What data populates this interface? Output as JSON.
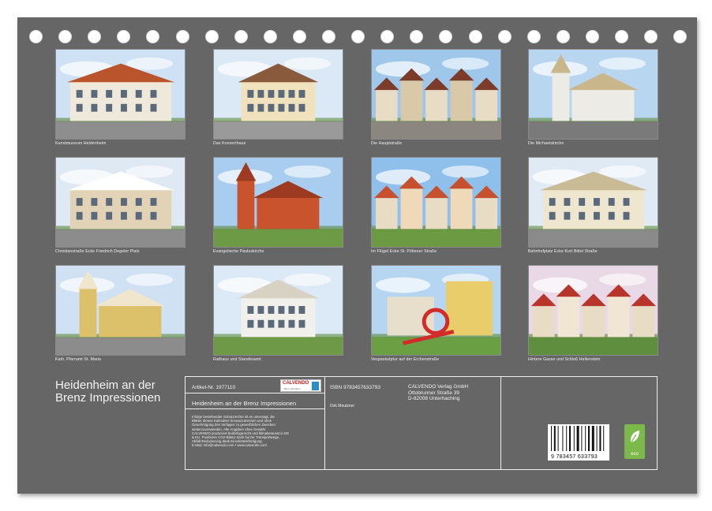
{
  "title": "Heidenheim an der Brenz Impressionen",
  "photos": [
    {
      "caption": "Kunstmuseum Heidenheim",
      "icon": "building-photo"
    },
    {
      "caption": "Das Konzerthaus",
      "icon": "building-photo"
    },
    {
      "caption": "Die Hauptstraße",
      "icon": "street-photo"
    },
    {
      "caption": "Die Michaelskirche",
      "icon": "church-photo"
    },
    {
      "caption": "Christianstraße Ecke Friedrich Degeler Platz",
      "icon": "building-photo"
    },
    {
      "caption": "Evangelische Pauluskirche",
      "icon": "church-photo"
    },
    {
      "caption": "Im Flügel Ecke St. Pöltener Straße",
      "icon": "street-photo"
    },
    {
      "caption": "Bahnhofplatz Ecke Kurt Bittel Straße",
      "icon": "building-photo"
    },
    {
      "caption": "Kath. Pfarramt St. Maria",
      "icon": "church-photo"
    },
    {
      "caption": "Rathaus und Standesamt",
      "icon": "building-photo"
    },
    {
      "caption": "Vespaskulptur auf der Erchenstraße",
      "icon": "sculpture-photo"
    },
    {
      "caption": "Hintere Gasse und Schloß Hellenstein",
      "icon": "street-photo"
    }
  ],
  "info": {
    "article_label": "Artikel-Nr. 1977110",
    "calendar_title": "Heidenheim an der Brenz Impressionen",
    "fineprint": [
      "Infolge bestehender Schutzrechte ist es untersagt, die",
      "Blätter dieses Kalenders herauszutrennen und ohne",
      "Genehmigung des Verlages zu gewerblichen Zwecken",
      "weiterzuverwenden. Alle Angaben ohne Gewähr.",
      "CALVENDO produziert bedarfsgerecht und klimabewusst in DE",
      "& EU. Positivere CO2-Bilanz dank kurzer Transportwege,",
      "Abfall-Reduzierung dank Einzelstückfertigung.",
      "E-Mail: info@calvendo.com • www.calvendo.com"
    ],
    "isbn": "ISBN 9783457633793",
    "author": "Dirk Meutzner",
    "publisher": [
      "CALVENDO Verlag GmbH",
      "Ottobrunner Straße 39",
      "D-82008 Unterhaching"
    ],
    "barcode_number": "9 783457 633793",
    "eco_label": "eco",
    "logo_name": "CALVENDO",
    "logo_sub": "Ideen verbinden"
  },
  "colors": {
    "background": "#666666",
    "eco_green": "#7cb84a",
    "logo_red": "#c81a1a"
  }
}
